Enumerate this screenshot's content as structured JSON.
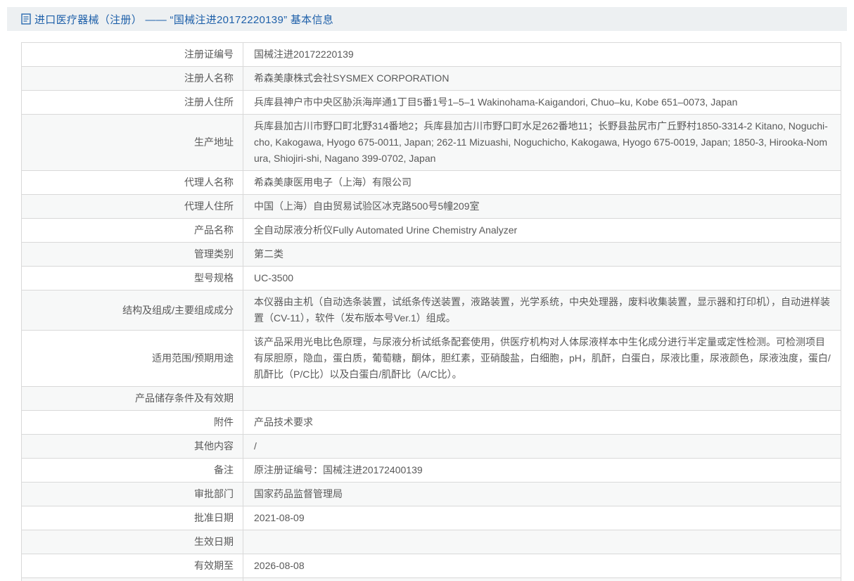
{
  "header": {
    "title": "进口医疗器械（注册） —— “国械注进20172220139” 基本信息"
  },
  "colors": {
    "title_blue": "#1d5fa9",
    "header_bar_bg": "#edf0f2",
    "row_stripe": "#f7f8f8",
    "border": "#d9d9d9",
    "text": "#595959"
  },
  "table": {
    "rows": [
      {
        "label": "注册证编号",
        "value": "国械注进20172220139"
      },
      {
        "label": "注册人名称",
        "value": "希森美康株式会社SYSMEX CORPORATION"
      },
      {
        "label": "注册人住所",
        "value": "兵库县神户市中央区胁浜海岸通1丁目5番1号1–5–1 Wakinohama-Kaigandori, Chuo–ku, Kobe 651–0073, Japan"
      },
      {
        "label": "生产地址",
        "value": "兵库县加古川市野口町北野314番地2；兵库县加古川市野口町水足262番地11；长野县盐尻市广丘野村1850-3314-2 Kitano, Noguchi-cho, Kakogawa, Hyogo 675-0011, Japan; 262-11 Mizuashi, Noguchicho, Kakogawa, Hyogo 675-0019, Japan; 1850-3, Hirooka-Nomura, Shiojiri-shi, Nagano 399-0702, Japan"
      },
      {
        "label": "代理人名称",
        "value": "希森美康医用电子（上海）有限公司"
      },
      {
        "label": "代理人住所",
        "value": "中国（上海）自由贸易试验区冰克路500号5幢209室"
      },
      {
        "label": "产品名称",
        "value": "全自动尿液分析仪Fully Automated Urine Chemistry Analyzer"
      },
      {
        "label": "管理类别",
        "value": "第二类"
      },
      {
        "label": "型号规格",
        "value": "UC-3500"
      },
      {
        "label": "结构及组成/主要组成成分",
        "value": "本仪器由主机（自动选条装置，试纸条传送装置，液路装置，光学系统，中央处理器，废料收集装置，显示器和打印机），自动进样装置（CV-11），软件（发布版本号Ver.1）组成。"
      },
      {
        "label": "适用范围/预期用途",
        "value": "该产品采用光电比色原理，与尿液分析试纸条配套使用，供医疗机构对人体尿液样本中生化成分进行半定量或定性检测。可检测项目有尿胆原，隐血，蛋白质，葡萄糖，酮体，胆红素，亚硝酸盐，白细胞，pH，肌酐，白蛋白，尿液比重，尿液颜色，尿液浊度，蛋白/肌酐比（P/C比）以及白蛋白/肌酐比（A/C比）。"
      },
      {
        "label": "产品储存条件及有效期",
        "value": ""
      },
      {
        "label": "附件",
        "value": "产品技术要求"
      },
      {
        "label": "其他内容",
        "value": "/"
      },
      {
        "label": "备注",
        "value": "原注册证编号：国械注进20172400139"
      },
      {
        "label": "审批部门",
        "value": "国家药品监督管理局"
      },
      {
        "label": "批准日期",
        "value": "2021-08-09"
      },
      {
        "label": "生效日期",
        "value": ""
      },
      {
        "label": "有效期至",
        "value": "2026-08-08"
      },
      {
        "label": "",
        "value": ""
      }
    ]
  }
}
